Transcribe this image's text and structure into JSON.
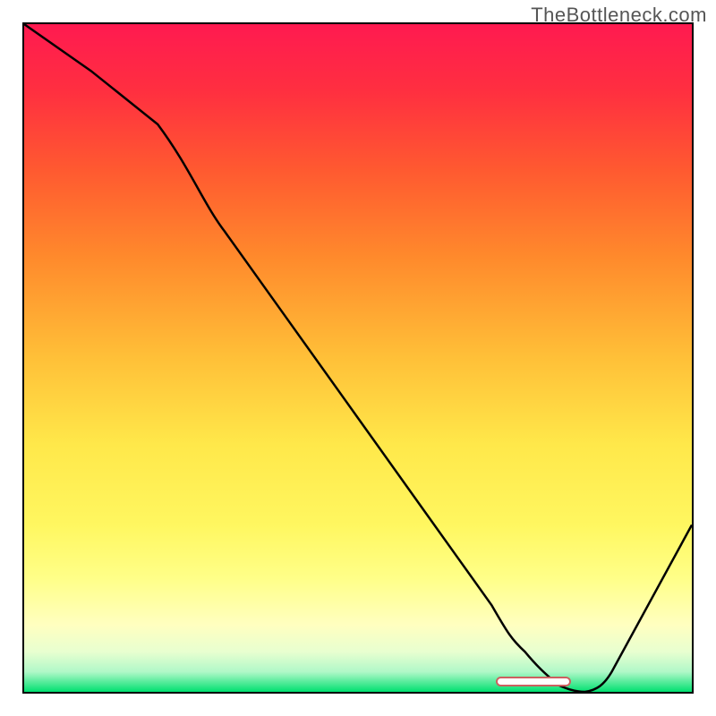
{
  "attribution": "TheBottleneck.com",
  "chart_data": {
    "type": "line",
    "title": "",
    "xlabel": "",
    "ylabel": "",
    "xlim": [
      0,
      100
    ],
    "ylim": [
      0,
      100
    ],
    "background": {
      "type": "vertical-gradient",
      "stops": [
        {
          "pos": 0.0,
          "color": "#ff1a50"
        },
        {
          "pos": 0.1,
          "color": "#ff2f40"
        },
        {
          "pos": 0.22,
          "color": "#ff5a30"
        },
        {
          "pos": 0.35,
          "color": "#ff8a2c"
        },
        {
          "pos": 0.5,
          "color": "#ffc038"
        },
        {
          "pos": 0.63,
          "color": "#ffe84a"
        },
        {
          "pos": 0.75,
          "color": "#fff760"
        },
        {
          "pos": 0.83,
          "color": "#ffff88"
        },
        {
          "pos": 0.9,
          "color": "#ffffc0"
        },
        {
          "pos": 0.94,
          "color": "#e8ffd0"
        },
        {
          "pos": 0.97,
          "color": "#b0f8c8"
        },
        {
          "pos": 1.0,
          "color": "#00e070"
        }
      ]
    },
    "series": [
      {
        "name": "curve",
        "x": [
          0,
          10,
          20,
          30,
          40,
          50,
          60,
          70,
          75,
          80,
          84,
          88,
          100
        ],
        "y": [
          100,
          93,
          85,
          69,
          55,
          41,
          27,
          13,
          6,
          1,
          0,
          3,
          25
        ]
      }
    ],
    "annotations": [
      {
        "name": "minimum-marker",
        "shape": "pill",
        "x": 82,
        "y": 1,
        "color": "#cc6060"
      }
    ]
  }
}
